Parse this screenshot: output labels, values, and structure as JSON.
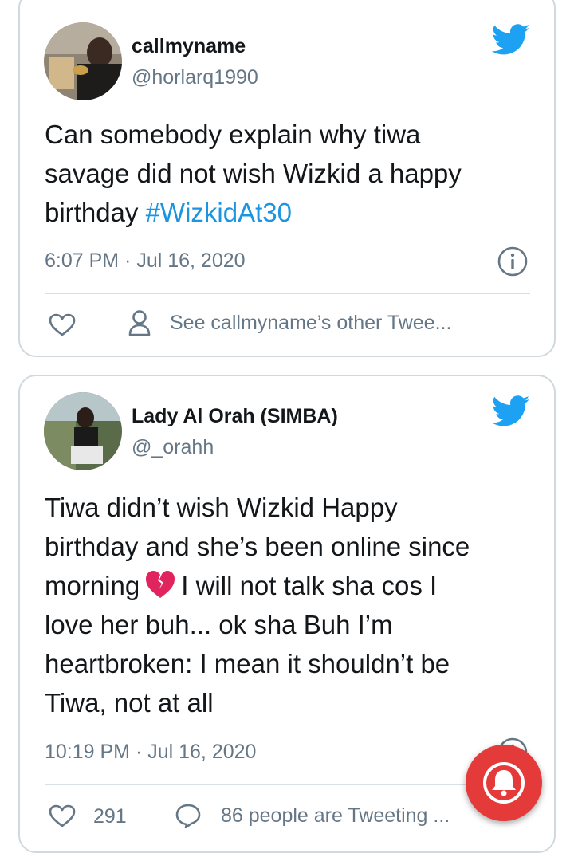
{
  "tweets": [
    {
      "display_name": "callmyname",
      "handle": "@horlarq1990",
      "text_lines": [
        "Can somebody explain why tiwa",
        "savage did not wish Wizkid a happy",
        "birthday "
      ],
      "hashtag": "#WizkidAt30",
      "timestamp": "6:07 PM · Jul 16, 2020",
      "actions": {
        "other_tweets": "See callmyname’s other Twee..."
      }
    },
    {
      "display_name": "Lady Al Orah (SIMBA)",
      "handle": "@_orahh",
      "text": {
        "line1": "Tiwa didn’t wish Wizkid Happy",
        "line2": "birthday and she’s been online since",
        "line3_before": "morning",
        "line3_after": "I will not talk sha cos I",
        "line4": "love her buh... ok sha Buh I’m",
        "line5": "heartbroken: I mean it shouldn’t be",
        "line6": "Tiwa, not at all"
      },
      "timestamp": "10:19 PM · Jul 16, 2020",
      "actions": {
        "likes": "291",
        "tweeting": "86 people are Tweeting ..."
      }
    }
  ],
  "colors": {
    "twitter_blue": "#1da1f2",
    "hashtag": "#1b95e0",
    "secondary_text": "#657786",
    "border": "#cfd9de",
    "notification": "#e53a3a",
    "broken_heart": "#e0245e"
  },
  "icons": [
    "twitter-bird-icon",
    "info-icon",
    "heart-icon",
    "person-icon",
    "comment-icon",
    "broken-heart-emoji",
    "bell-icon"
  ]
}
